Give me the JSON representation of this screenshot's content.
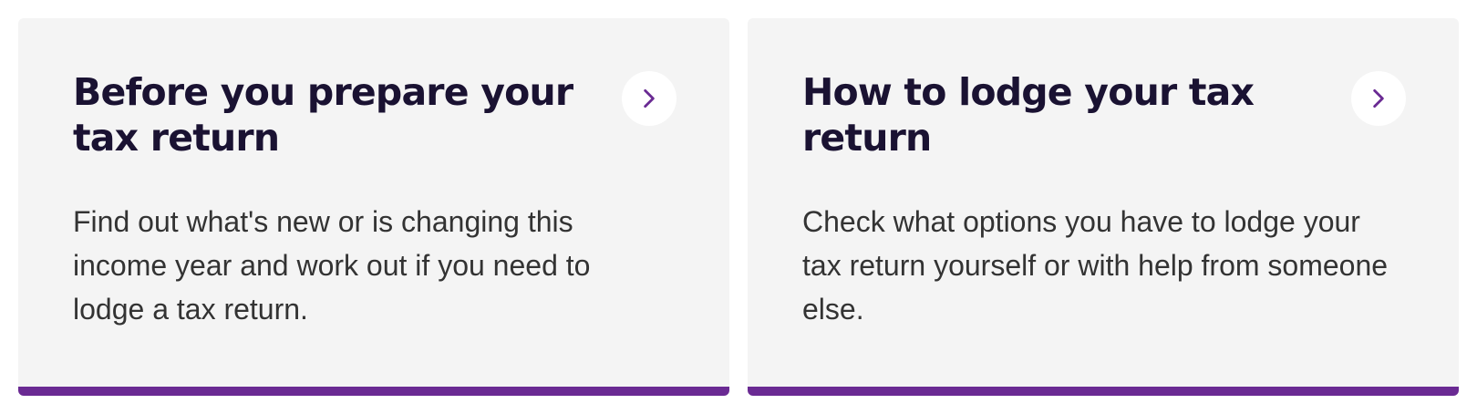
{
  "cards": [
    {
      "title": "Before you prepare your tax return",
      "description": "Find out what's new or is changing this income year and work out if you need to lodge a tax return.",
      "icon": "chevron-right-icon"
    },
    {
      "title": "How to lodge your tax return",
      "description": "Check what options you have to lodge your tax return yourself or with help from someone else.",
      "icon": "chevron-right-icon"
    }
  ],
  "colors": {
    "card_background": "#f4f4f4",
    "accent": "#6a2a93",
    "title_text": "#1a1232",
    "body_text": "#333333"
  }
}
